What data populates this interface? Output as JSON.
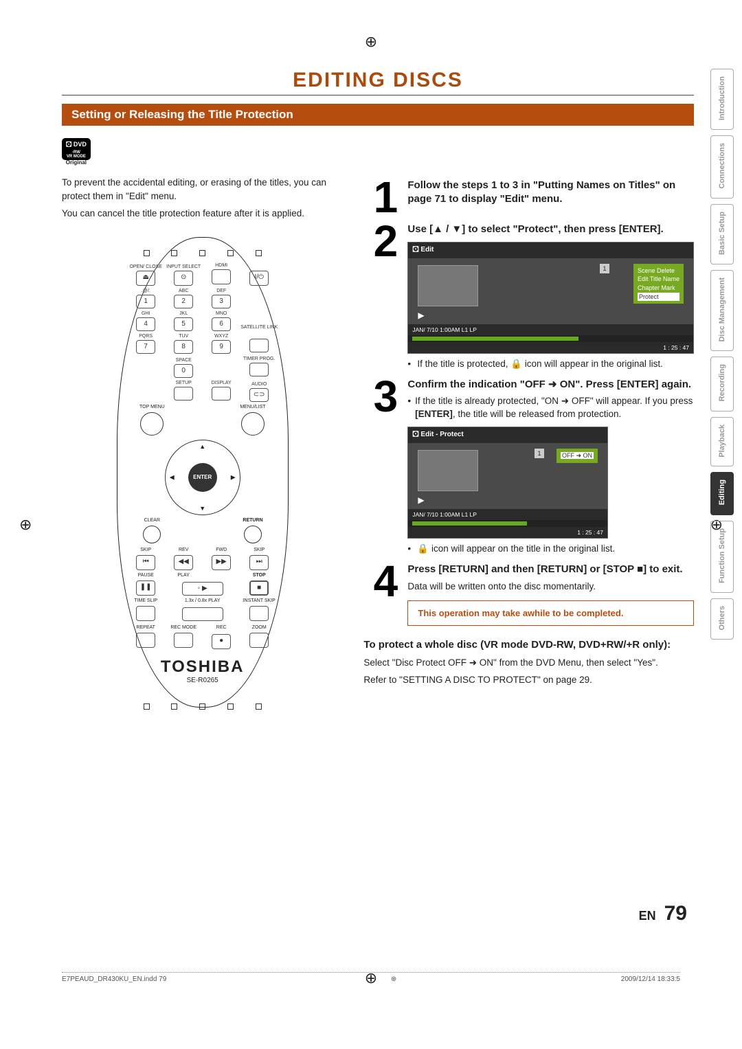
{
  "chapter_title": "EDITING DISCS",
  "section_title": "Setting or Releasing the Title Protection",
  "dvd_badge": {
    "line1": "DVD",
    "line2": "-RW",
    "line3": "VR MODE",
    "sub": "Original"
  },
  "intro1": "To prevent the accidental editing, or erasing of the titles, you can protect them in \"Edit\" menu.",
  "intro2": "You can cancel the title protection feature after it is applied.",
  "remote": {
    "brand": "TOSHIBA",
    "model": "SE-R0265",
    "labels": {
      "open": "OPEN/\nCLOSE",
      "input": "INPUT\nSELECT",
      "hdmi": "HDMI",
      "abc1": ".@/:",
      "abc2": "ABC",
      "abc3": "DEF",
      "ghi": "GHI",
      "jkl": "JKL",
      "mno": "MNO",
      "pqrs": "PQRS",
      "tuv": "TUV",
      "wxyz": "WXYZ",
      "sat": "SATELLITE\nLINK",
      "space": "SPACE",
      "timer": "TIMER\nPROG.",
      "setup": "SETUP",
      "display": "DISPLAY",
      "audio": "AUDIO",
      "topmenu": "TOP MENU",
      "menulist": "MENU/LIST",
      "clear": "CLEAR",
      "return": "RETURN",
      "enter": "ENTER",
      "skip": "SKIP",
      "rev": "REV",
      "fwd": "FWD",
      "pause": "PAUSE",
      "play": "PLAY",
      "stop": "STOP",
      "timeslip": "TIME SLIP",
      "rate": "1.3x / 0.8x PLAY",
      "instant": "INSTANT SKIP",
      "repeat": "REPEAT",
      "recmode": "REC MODE",
      "rec": "REC",
      "zoom": "ZOOM"
    },
    "keys": {
      "1": "1",
      "2": "2",
      "3": "3",
      "4": "4",
      "5": "5",
      "6": "6",
      "7": "7",
      "8": "8",
      "9": "9",
      "0": "0",
      "power": "I/⏻",
      "eject": "⏏",
      "dot": "⊙",
      "cd": "⊂⊃"
    }
  },
  "steps": {
    "s1": {
      "num": "1",
      "title": "Follow the steps 1 to 3 in \"Putting Names on Titles\" on page 71 to display \"Edit\" menu."
    },
    "s2": {
      "num": "2",
      "title": "Use [▲ / ▼] to select \"Protect\", then press [ENTER].",
      "screenshot": {
        "title": "Edit",
        "menu": [
          "Scene Delete",
          "Edit Title Name",
          "Chapter Mark",
          "Protect"
        ],
        "highlight": "Protect",
        "info": "JAN/ 7/10 1:00AM L1   LP",
        "time": "1 : 25 : 47",
        "num": "1"
      },
      "bullet": "If the title is protected, 🔒 icon will appear in the original list."
    },
    "s3": {
      "num": "3",
      "title": "Confirm the indication \"OFF ➜ ON\". Press [ENTER] again.",
      "bullet1_a": "If the title is already protected, \"ON ➜ OFF\" will appear. If you press ",
      "bullet1_key": "[ENTER]",
      "bullet1_b": ", the title will be released from protection.",
      "screenshot": {
        "title": "Edit - Protect",
        "toggle": "OFF ➜ ON",
        "info": "JAN/ 7/10 1:00AM L1   LP",
        "time": "1 : 25 : 47",
        "num": "1"
      },
      "bullet2": "🔒 icon will appear on the title in the original list."
    },
    "s4": {
      "num": "4",
      "title": "Press [RETURN] and then [RETURN] or [STOP ■] to exit.",
      "sub": "Data will be written onto the disc momentarily.",
      "note": "This operation may take awhile to be completed."
    }
  },
  "whole_disc": {
    "heading": "To protect a whole disc (VR mode DVD-RW, DVD+RW/+R only):",
    "line1": "Select \"Disc Protect OFF ➜ ON\" from the DVD Menu, then select \"Yes\".",
    "line2": "Refer to \"SETTING A DISC TO PROTECT\" on page 29."
  },
  "sidebar": [
    "Introduction",
    "Connections",
    "Basic Setup",
    "Disc Management",
    "Recording",
    "Playback",
    "Editing",
    "Function Setup",
    "Others"
  ],
  "sidebar_active": "Editing",
  "page_lang": "EN",
  "page_num": "79",
  "footer_left": "E7PEAUD_DR430KU_EN.indd   79",
  "footer_right": "2009/12/14   18:33:5"
}
